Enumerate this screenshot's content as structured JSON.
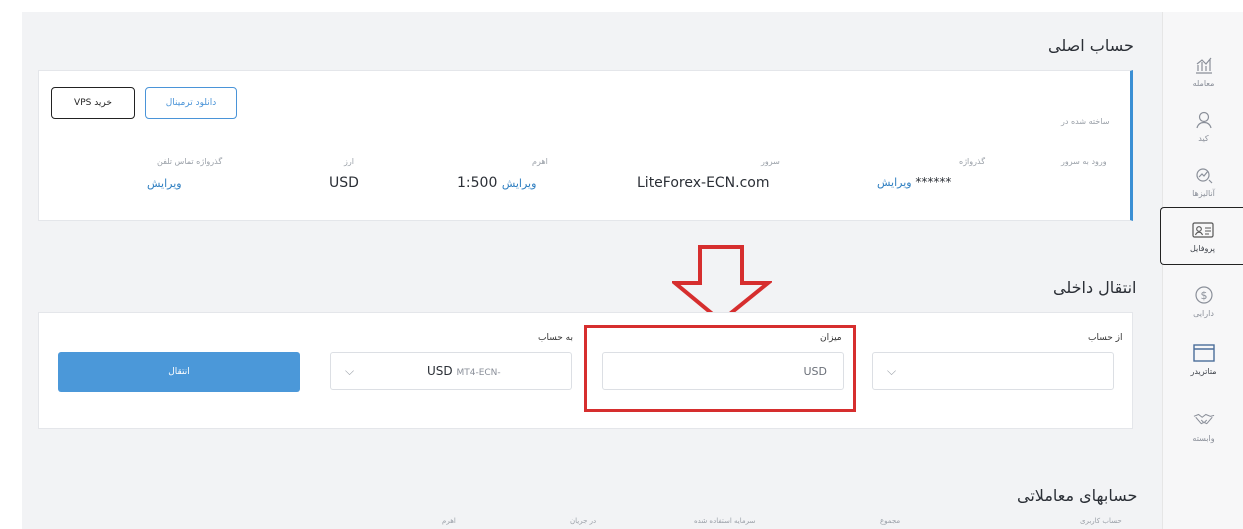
{
  "sidebar": {
    "items": [
      {
        "label": "معامله",
        "icon": "trading-chart-icon"
      },
      {
        "label": "کید",
        "icon": "user-icon"
      },
      {
        "label": "آنالیزها",
        "icon": "analytics-icon"
      },
      {
        "label": "پروفایل",
        "icon": "profile-card-icon",
        "active": true
      },
      {
        "label": "دارایی",
        "icon": "dollar-icon"
      },
      {
        "label": "متاتریدر",
        "icon": "window-icon"
      },
      {
        "label": "وابسته",
        "icon": "handshake-icon"
      }
    ]
  },
  "main_account": {
    "title": "حساب اصلی",
    "buy_vps_label": "خرید VPS",
    "download_terminal_label": "دانلود ترمینال",
    "created_label": "ساخته شده در",
    "fields": {
      "login_label": "ورود به سرور",
      "password_label": "گذرواژه",
      "password_value": "******",
      "password_edit": "ویرایش",
      "server_label": "سرور",
      "server_value": "LiteForex-ECN.com",
      "leverage_label": "اهرم",
      "leverage_value": "1:500",
      "leverage_edit": "ویرایش",
      "currency_label": "ارز",
      "currency_value": "USD",
      "phone_password_label": "گذرواژه تماس تلفن",
      "phone_password_edit": "ویرایش"
    }
  },
  "internal_transfer": {
    "title": "انتقال داخلی",
    "from_label": "از حساب",
    "amount_label": "میزان",
    "amount_currency": "USD",
    "to_label": "به حساب",
    "to_value": "USD",
    "to_value_suffix": "MT4-ECN-",
    "transfer_button": "انتقال"
  },
  "trading_accounts": {
    "title": "حسابهای معاملاتی",
    "columns": [
      "حساب کاربری",
      "مجموع",
      "سرمایه استفاده شده",
      "در جریان",
      "اهرم"
    ]
  },
  "colors": {
    "accent": "#4b98d9",
    "highlight": "#d62e2e"
  }
}
